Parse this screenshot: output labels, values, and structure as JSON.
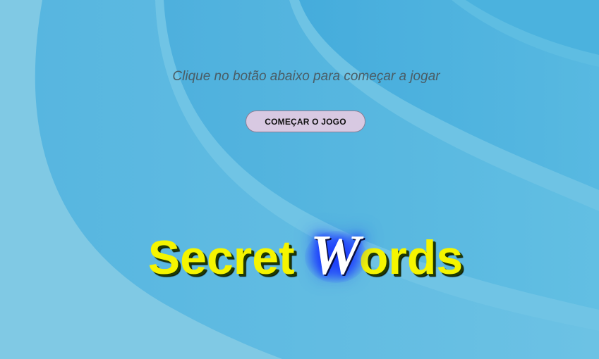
{
  "instruction_text": "Clique no botão abaixo para começar a jogar",
  "start_button_label": "COMEÇAR O JOGO",
  "title": {
    "part1": "Secret",
    "initial": "W",
    "part2": "ords"
  },
  "colors": {
    "background_base": "#7ec8e3",
    "background_wave": "#4fb5df",
    "title_text": "#f5f500",
    "title_initial_glow": "#1a3cff",
    "button_background": "#d8c9e2"
  }
}
